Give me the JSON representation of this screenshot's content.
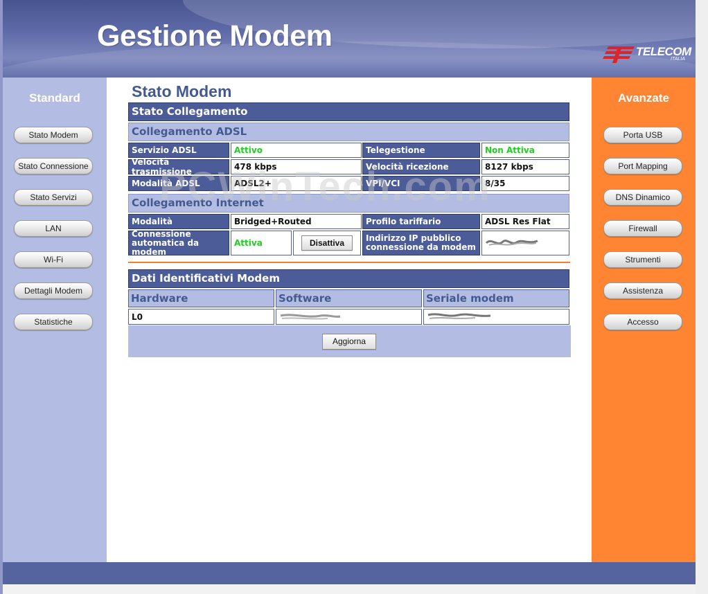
{
  "header": {
    "title": "Gestione Modem"
  },
  "logo": {
    "name": "TELECOM",
    "sub": "ITALIA"
  },
  "sidebar_left": {
    "title": "Standard",
    "items": [
      "Stato Modem",
      "Stato Connessione",
      "Stato Servizi",
      "LAN",
      "Wi-Fi",
      "Dettagli Modem",
      "Statistiche"
    ]
  },
  "sidebar_right": {
    "title": "Avanzate",
    "items": [
      "Porta USB",
      "Port Mapping",
      "DNS Dinamico",
      "Firewall",
      "Strumenti",
      "Assistenza",
      "Accesso"
    ]
  },
  "main": {
    "title": "Stato Modem",
    "stato_collegamento": "Stato Collegamento",
    "adsl": {
      "title": "Collegamento ADSL",
      "servizio_label": "Servizio ADSL",
      "servizio_value": "Attivo",
      "telegestione_label": "Telegestione",
      "telegestione_value": "Non Attiva",
      "vel_tx_label": "Velocità trasmissione",
      "vel_tx_value": "478 kbps",
      "vel_rx_label": "Velocità ricezione",
      "vel_rx_value": "8127 kbps",
      "modalita_label": "Modalità ADSL",
      "modalita_value": "ADSL2+",
      "vpi_label": "VPI/VCI",
      "vpi_value": "8/35"
    },
    "internet": {
      "title": "Collegamento Internet",
      "modalita_label": "Modalità",
      "modalita_value": "Bridged+Routed",
      "profilo_label": "Profilo tariffario",
      "profilo_value": "ADSL Res Flat",
      "connessione_label_1": "Connessione",
      "connessione_label_2": "automatica da modem",
      "connessione_value": "Attiva",
      "disattiva_button": "Disattiva",
      "ip_label_1": "Indirizzo IP pubblico",
      "ip_label_2": "connessione da modem"
    },
    "dati": {
      "title": "Dati Identificativi Modem",
      "col_hardware": "Hardware",
      "col_software": "Software",
      "col_seriale": "Seriale modem",
      "hardware_value": "L0"
    },
    "aggiorna_button": "Aggiorna"
  },
  "watermark": "PCWinTech.com",
  "colors": {
    "header_blue": "#5d69a6",
    "left_sidebar": "#b3bde3",
    "right_sidebar": "#ff8533",
    "band_dark": "#4c5c98",
    "active_green": "#22cc22",
    "title_blue": "#445a8f"
  }
}
